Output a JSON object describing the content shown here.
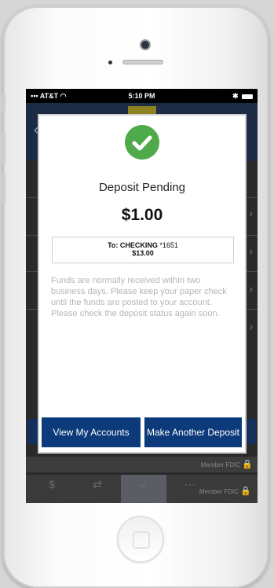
{
  "status_bar": {
    "carrier": "AT&T",
    "time": "5:10 PM"
  },
  "modal": {
    "icon": "checkmark-circle-icon",
    "title": "Deposit Pending",
    "amount": "$1.00",
    "destination_prefix": "To: CHECKING",
    "destination_account": "*1651",
    "destination_balance": "$13.00",
    "info": "Funds are normally received within two business days. Please keep your paper check until the funds are posted to your account. Please check the deposit status again soon.",
    "view_accounts_label": "View My Accounts",
    "make_another_label": "Make Another Deposit"
  },
  "background_app": {
    "footer_text": "Member FDIC",
    "tabbar_footer": "Member FDIC"
  },
  "colors": {
    "primary_button": "#0d3a7a",
    "success": "#4eaa4a"
  }
}
